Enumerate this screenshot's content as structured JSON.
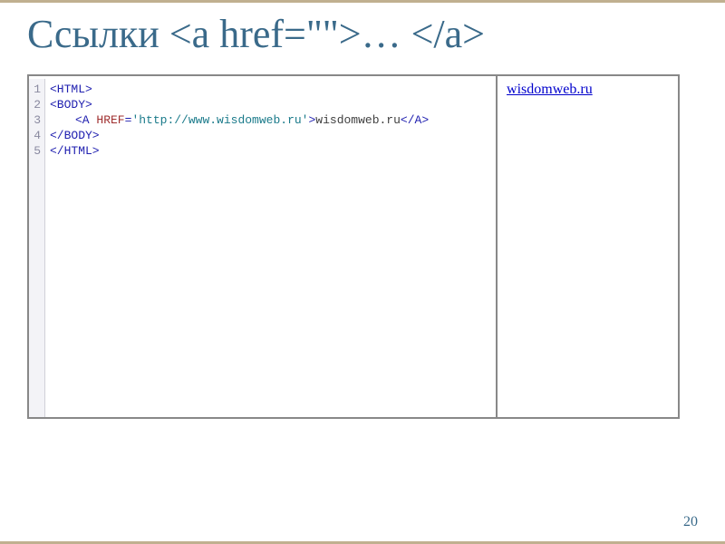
{
  "slide": {
    "title": "Ссылки <a href=\"\">… </a>",
    "page_number": "20"
  },
  "code": {
    "lines_count": 5,
    "line1_tag": "<html>",
    "line2_tag": "<body>",
    "line3_open_a": "<a ",
    "line3_attr": "href",
    "line3_eq": "=",
    "line3_val": "'http://www.wisdomweb.ru'",
    "line3_close": ">",
    "line3_text": "wisdomweb.ru",
    "line3_close_a": "</a>",
    "line4_tag": "</body>",
    "line5_tag": "</html>"
  },
  "preview": {
    "link_text": "wisdomweb.ru"
  },
  "gutter": {
    "n1": "1",
    "n2": "2",
    "n3": "3",
    "n4": "4",
    "n5": "5"
  }
}
